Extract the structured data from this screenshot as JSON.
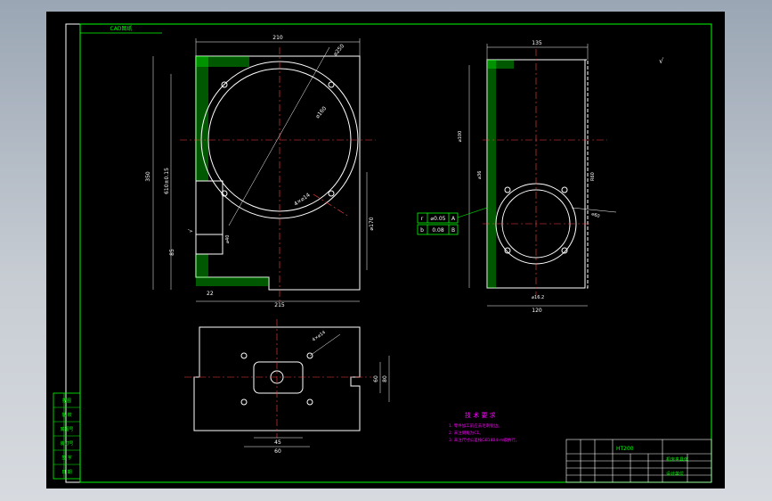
{
  "colors": {
    "background": "#000000",
    "outline": "#ffffff",
    "border": "#00ff00",
    "centerline": "#ff4040",
    "dimension": "#00ff00",
    "notes": "#ff00ff",
    "section_hatch": "#00ff00",
    "title_block": "#ffffff"
  },
  "stamp": "CAD图纸",
  "dimensions": {
    "top_width": "210",
    "depth": "350",
    "height_left": "610±0.15",
    "height_low": "85",
    "bottom_offset": "22",
    "bottom_width": "215",
    "bore": "⌀160",
    "right_h": "⌀170",
    "diag1": "⌀250",
    "diag2": "4×⌀14",
    "seat": "⌀40",
    "side_top": "135",
    "side_tol": "⌀100",
    "side_bottom": "120",
    "side_hole": "⌀60",
    "side_r": "R60",
    "left_small": "⌀36",
    "bot_dim1": "⌀16.2",
    "plan_hole": "4×⌀14",
    "plan_w1": "45",
    "plan_w2": "60",
    "plan_h1": "60",
    "plan_h2": "80"
  },
  "tolerance_frames": [
    {
      "sym": "r",
      "val": "⌀0.05",
      "ref": "A"
    },
    {
      "sym": "b",
      "val": "0.08",
      "ref": "B"
    }
  ],
  "technical_notes": {
    "title": "技 术 要 求",
    "items": [
      "1. 零件加工前应去毛刺锐边。",
      "2. 未注倒角为C1。",
      "3. 未注尺寸公差按GB1804-m级执行。"
    ]
  },
  "left_table": [
    "描图",
    "描 校",
    "底图号",
    "装订号",
    "签 字",
    "日 期"
  ],
  "title_block": {
    "material": "HT200",
    "drawing_name": "机床夹具体",
    "company": "设计单位"
  },
  "roughness": "√"
}
